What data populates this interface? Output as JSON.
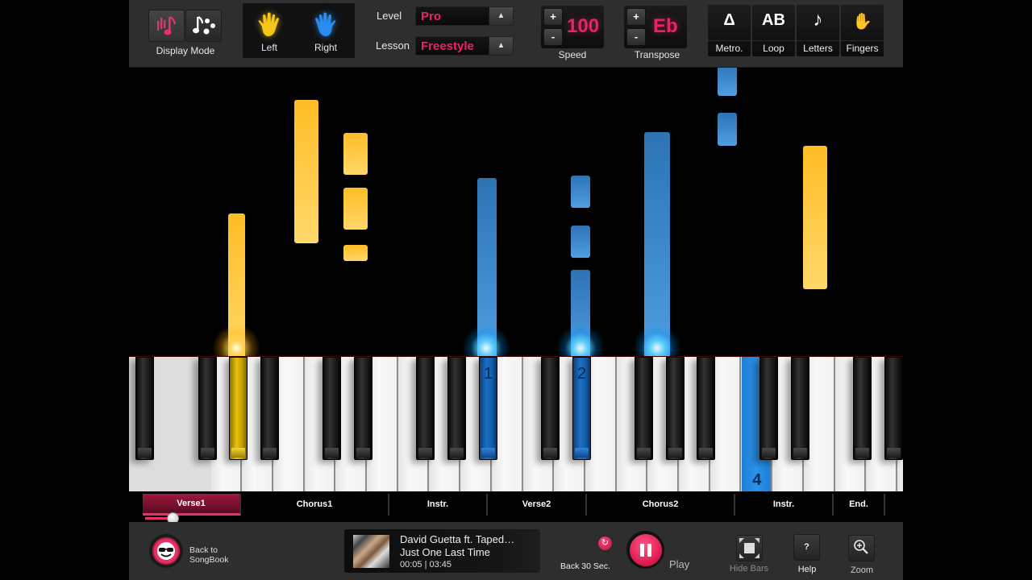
{
  "toolbar": {
    "display_mode": {
      "label": "Display Mode",
      "options": [
        "hands-notes-icon",
        "scatter-notes-icon"
      ],
      "active": 0
    },
    "hands": {
      "left_label": "Left",
      "right_label": "Right",
      "left_color": "#f5c518",
      "right_color": "#2a8cf0"
    },
    "level": {
      "label": "Level",
      "value": "Pro"
    },
    "lesson": {
      "label": "Lesson",
      "value": "Freestyle"
    },
    "speed": {
      "label": "Speed",
      "value": "100",
      "plus": "+",
      "minus": "-"
    },
    "transpose": {
      "label": "Transpose",
      "value": "Eb",
      "plus": "+",
      "minus": "-"
    },
    "toggles": [
      {
        "icon": "metronome-icon",
        "glyph": "Δ",
        "label": "Metro."
      },
      {
        "icon": "loop-ab-icon",
        "glyph": "AB",
        "label": "Loop"
      },
      {
        "icon": "music-note-icon",
        "glyph": "♪",
        "label": "Letters"
      },
      {
        "icon": "fingers-hand-icon",
        "glyph": "✋",
        "label": "Fingers"
      }
    ]
  },
  "keyboard": {
    "fingerings": [
      {
        "key": "black-10",
        "finger": "1"
      },
      {
        "key": "black-12",
        "finger": "2"
      },
      {
        "key": "white-17",
        "finger": "4"
      }
    ]
  },
  "sections": [
    {
      "label": "Verse1",
      "active": true
    },
    {
      "label": "Chorus1",
      "active": false
    },
    {
      "label": "Instr.",
      "active": false
    },
    {
      "label": "Verse2",
      "active": false
    },
    {
      "label": "Chorus2",
      "active": false
    },
    {
      "label": "Instr.",
      "active": false
    },
    {
      "label": "End.",
      "active": false
    }
  ],
  "playback": {
    "progress_fraction": 0.03,
    "back_songbook": "Back to\nSongBook",
    "back_songbook_line1": "Back to",
    "back_songbook_line2": "SongBook",
    "now_playing": {
      "artist": "David Guetta ft. Taped…",
      "title": "Just One Last Time",
      "time": "00:05 | 03:45"
    },
    "back30_label": "Back 30 Sec.",
    "play_label": "Play",
    "hide_bars_label": "Hide Bars",
    "help_label": "Help",
    "help_glyph": "?",
    "zoom_label": "Zoom",
    "accent_color": "#e8306a"
  }
}
